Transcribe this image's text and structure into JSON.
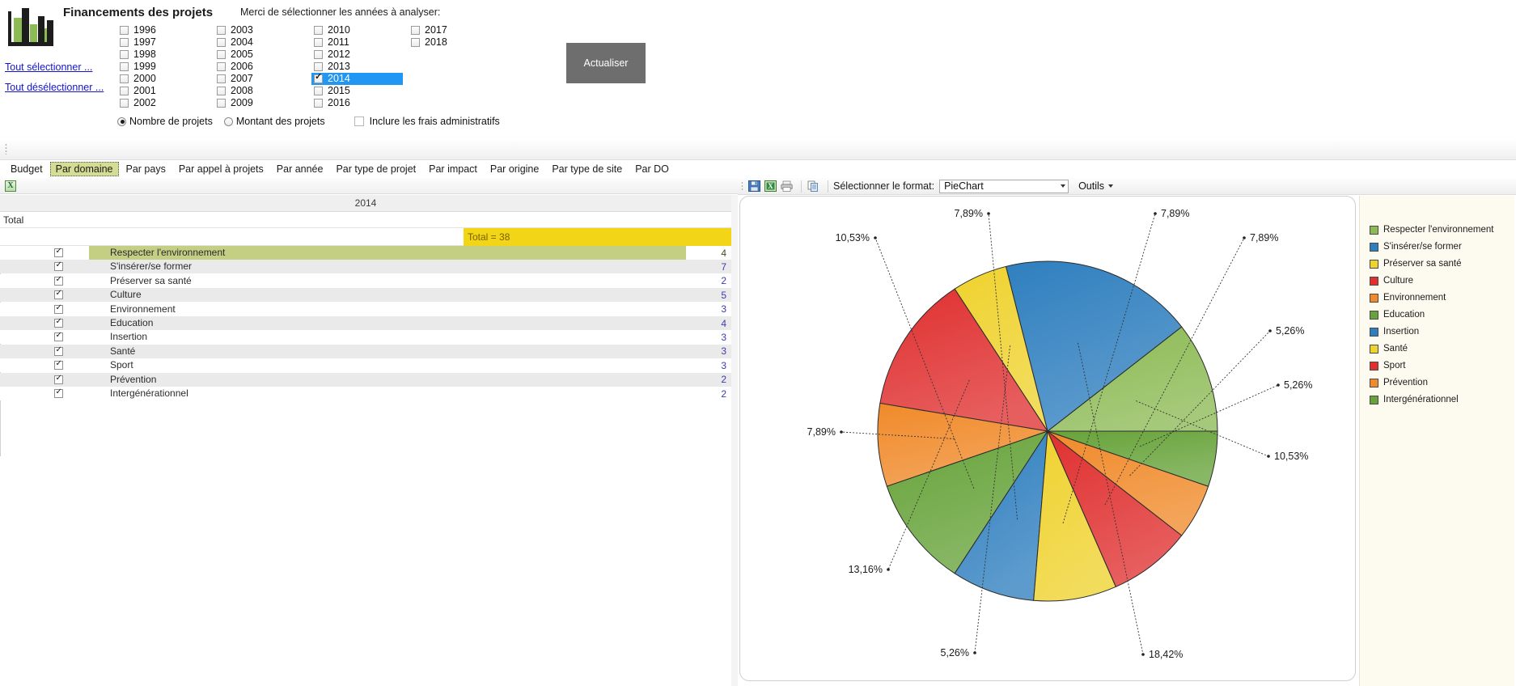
{
  "app": {
    "logo_icon": "bar-chart-logo",
    "panel_title": "Financements des projets",
    "years_instruction": "Merci de sélectionner les années à analyser:",
    "select_all_label": "Tout sélectionner ...",
    "deselect_all_label": "Tout désélectionner ...",
    "refresh_label": "Actualiser"
  },
  "year_columns": [
    {
      "years": [
        {
          "label": "1996",
          "checked": false,
          "selected": false
        },
        {
          "label": "1997",
          "checked": false,
          "selected": false
        },
        {
          "label": "1998",
          "checked": false,
          "selected": false
        },
        {
          "label": "1999",
          "checked": false,
          "selected": false
        },
        {
          "label": "2000",
          "checked": false,
          "selected": false
        },
        {
          "label": "2001",
          "checked": false,
          "selected": false
        },
        {
          "label": "2002",
          "checked": false,
          "selected": false
        }
      ]
    },
    {
      "years": [
        {
          "label": "2003",
          "checked": false,
          "selected": false
        },
        {
          "label": "2004",
          "checked": false,
          "selected": false
        },
        {
          "label": "2005",
          "checked": false,
          "selected": false
        },
        {
          "label": "2006",
          "checked": false,
          "selected": false
        },
        {
          "label": "2007",
          "checked": false,
          "selected": false
        },
        {
          "label": "2008",
          "checked": false,
          "selected": false
        },
        {
          "label": "2009",
          "checked": false,
          "selected": false
        }
      ]
    },
    {
      "years": [
        {
          "label": "2010",
          "checked": false,
          "selected": false
        },
        {
          "label": "2011",
          "checked": false,
          "selected": false
        },
        {
          "label": "2012",
          "checked": false,
          "selected": false
        },
        {
          "label": "2013",
          "checked": false,
          "selected": false
        },
        {
          "label": "2014",
          "checked": true,
          "selected": true
        },
        {
          "label": "2015",
          "checked": false,
          "selected": false
        },
        {
          "label": "2016",
          "checked": false,
          "selected": false
        }
      ]
    },
    {
      "years": [
        {
          "label": "2017",
          "checked": false,
          "selected": false
        },
        {
          "label": "2018",
          "checked": false,
          "selected": false
        }
      ]
    }
  ],
  "options": {
    "radio_count_label": "Nombre de projets",
    "radio_amount_label": "Montant des projets",
    "radio_selected": "count",
    "admin_fee_label": "Inclure les frais administratifs",
    "admin_fee_checked": false
  },
  "tabs": [
    {
      "label": "Budget",
      "active": false
    },
    {
      "label": "Par domaine",
      "active": true
    },
    {
      "label": "Par pays",
      "active": false
    },
    {
      "label": "Par appel à projets",
      "active": false
    },
    {
      "label": "Par année",
      "active": false
    },
    {
      "label": "Par type de projet",
      "active": false
    },
    {
      "label": "Par impact",
      "active": false
    },
    {
      "label": "Par origine",
      "active": false
    },
    {
      "label": "Par type de site",
      "active": false
    },
    {
      "label": "Par DO",
      "active": false
    }
  ],
  "grid": {
    "export_icon": "excel-export-icon",
    "year_header": "2014",
    "total_label": "Total",
    "total_badge": "Total = 38",
    "rows": [
      {
        "name": "Respecter l'environnement",
        "value": "4",
        "checked": true,
        "highlight": true
      },
      {
        "name": "S'insérer/se former",
        "value": "7",
        "checked": true,
        "highlight": false
      },
      {
        "name": "Préserver sa santé",
        "value": "2",
        "checked": true,
        "highlight": false
      },
      {
        "name": "Culture",
        "value": "5",
        "checked": true,
        "highlight": false
      },
      {
        "name": "Environnement",
        "value": "3",
        "checked": true,
        "highlight": false
      },
      {
        "name": "Education",
        "value": "4",
        "checked": true,
        "highlight": false
      },
      {
        "name": "Insertion",
        "value": "3",
        "checked": true,
        "highlight": false
      },
      {
        "name": "Santé",
        "value": "3",
        "checked": true,
        "highlight": false
      },
      {
        "name": "Sport",
        "value": "3",
        "checked": true,
        "highlight": false
      },
      {
        "name": "Prévention",
        "value": "2",
        "checked": true,
        "highlight": false
      },
      {
        "name": "Intergénérationnel",
        "value": "2",
        "checked": true,
        "highlight": false
      }
    ]
  },
  "chart_toolbar": {
    "icons": [
      "save-icon",
      "excel-export-icon",
      "print-icon",
      "copy-icon"
    ],
    "format_label": "Sélectionner le format:",
    "format_value": "PieChart",
    "tools_label": "Outils"
  },
  "chart_data": {
    "type": "pie",
    "title": "",
    "legend_position": "right",
    "categories": [
      "Respecter l'environnement",
      "S'insérer/se former",
      "Préserver sa santé",
      "Culture",
      "Environnement",
      "Education",
      "Insertion",
      "Santé",
      "Sport",
      "Prévention",
      "Intergénérationnel"
    ],
    "values": [
      4,
      7,
      2,
      5,
      3,
      4,
      3,
      3,
      3,
      2,
      2
    ],
    "total": 38,
    "percent_labels": [
      "10,53%",
      "18,42%",
      "5,26%",
      "13,16%",
      "7,89%",
      "10,53%",
      "7,89%",
      "7,89%",
      "7,89%",
      "5,26%",
      "5,26%"
    ],
    "percents": [
      10.53,
      18.42,
      5.26,
      13.16,
      7.89,
      10.53,
      7.89,
      7.89,
      7.89,
      5.26,
      5.26
    ],
    "colors": [
      "#8cba54",
      "#2f7fbf",
      "#efd22e",
      "#e03030",
      "#f08a2a",
      "#67a33a",
      "#2f7fbf",
      "#efd22e",
      "#e03030",
      "#f08a2a",
      "#67a33a"
    ]
  }
}
